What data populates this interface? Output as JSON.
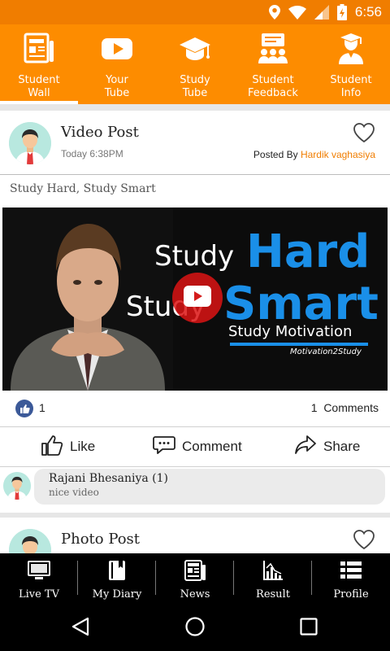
{
  "status_bar": {
    "time": "6:56"
  },
  "top_nav": {
    "tabs": [
      {
        "label_line1": "Student",
        "label_line2": "Wall",
        "icon": "newspaper-icon",
        "active": true
      },
      {
        "label_line1": "Your",
        "label_line2": "Tube",
        "icon": "youtube-icon",
        "active": false
      },
      {
        "label_line1": "Study",
        "label_line2": "Tube",
        "icon": "graduation-cap-icon",
        "active": false
      },
      {
        "label_line1": "Student",
        "label_line2": "Feedback",
        "icon": "feedback-icon",
        "active": false
      },
      {
        "label_line1": "Student",
        "label_line2": "Info",
        "icon": "graduate-icon",
        "active": false
      }
    ]
  },
  "post": {
    "type": "Video Post",
    "time": "Today 6:38PM",
    "posted_by_label": "Posted By",
    "author": "Hardik vaghasiya",
    "caption": "Study Hard, Study Smart",
    "video": {
      "line1_small": "Study",
      "line1_big": "Hard",
      "line2_small": "Study",
      "line2_big": "Smart",
      "subtitle": "Study Motivation",
      "brand": "Motivation2Study"
    },
    "likes": "1",
    "comments_count": "1",
    "comments_label": "Comments",
    "actions": {
      "like": "Like",
      "comment": "Comment",
      "share": "Share"
    },
    "comment": {
      "name": "Rajani Bhesaniya (1)",
      "text": "nice video"
    }
  },
  "next_post": {
    "type": "Photo Post"
  },
  "bottom_nav": {
    "items": [
      {
        "label": "Live TV",
        "icon": "tv-icon"
      },
      {
        "label": "My Diary",
        "icon": "diary-icon"
      },
      {
        "label": "News",
        "icon": "news-icon"
      },
      {
        "label": "Result",
        "icon": "chart-icon"
      },
      {
        "label": "Profile",
        "icon": "list-icon"
      }
    ]
  },
  "colors": {
    "primary": "#fd8c00",
    "status_bar": "#f07d00",
    "link": "#f07d00",
    "video_accent": "#1a8fe8"
  }
}
